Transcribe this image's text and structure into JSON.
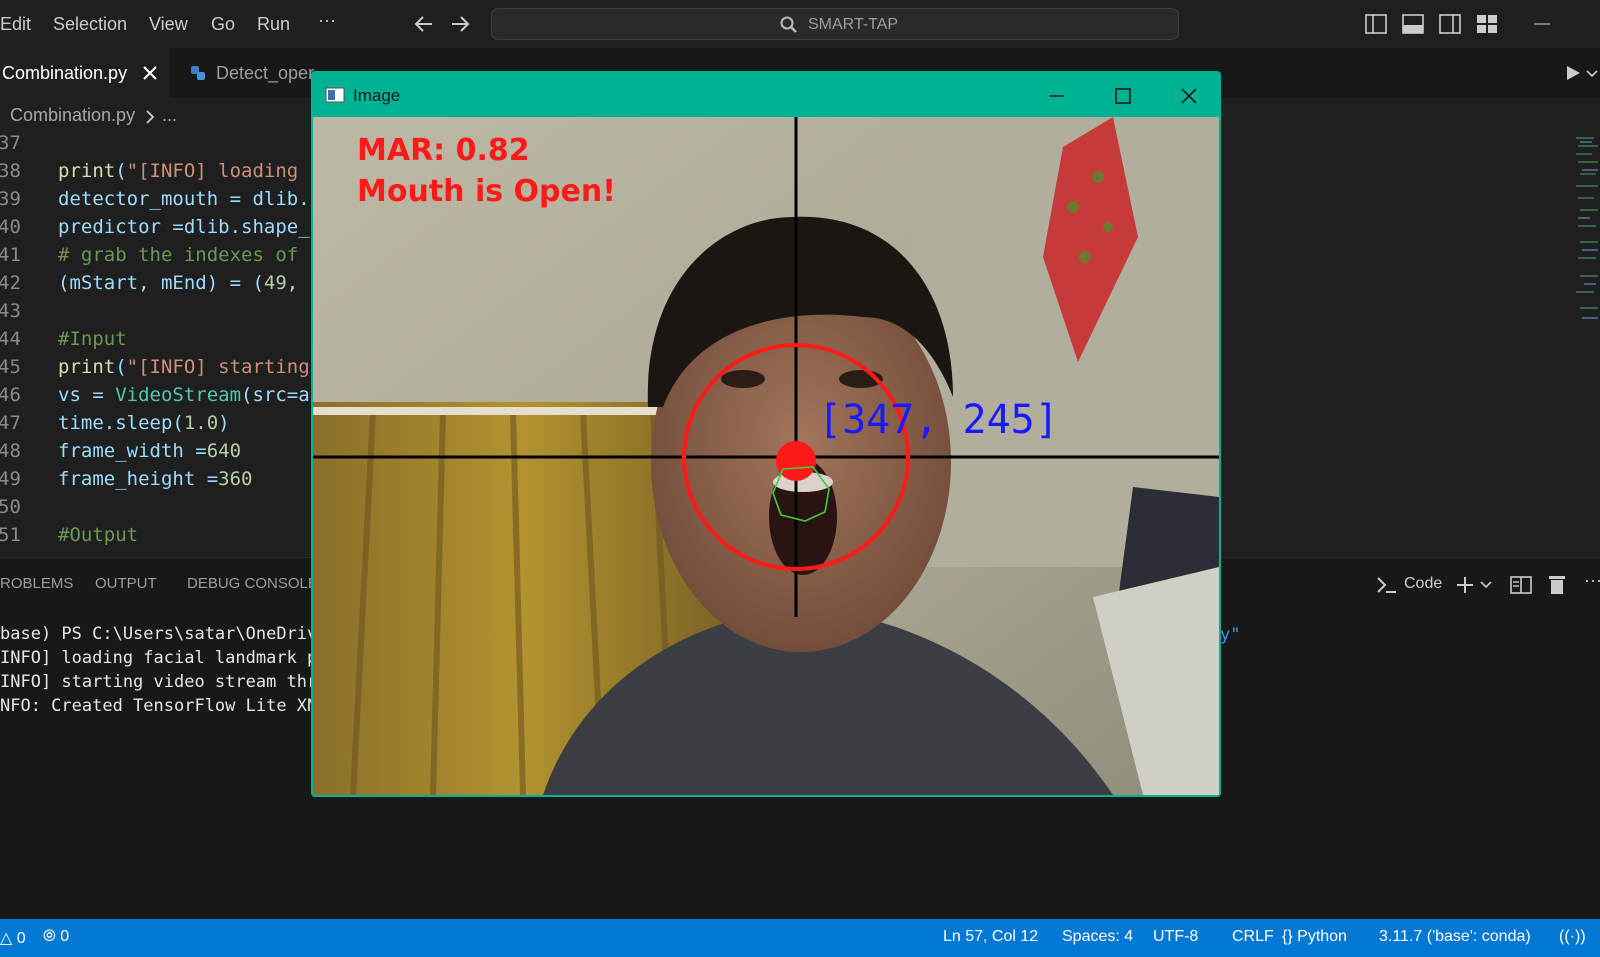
{
  "menu": [
    "Edit",
    "Selection",
    "View",
    "Go",
    "Run",
    "···"
  ],
  "search": {
    "text": "SMART-TAP",
    "icon": "search-icon"
  },
  "tabs": [
    {
      "label": "Combination.py",
      "active": true
    },
    {
      "label": "Detect_oper",
      "active": false
    }
  ],
  "breadcrumb": {
    "file": "Combination.py",
    "rest": "..."
  },
  "editor": {
    "lines": [
      {
        "num": "37",
        "code": ""
      },
      {
        "num": "38",
        "code": "print(\"[INFO] loading"
      },
      {
        "num": "39",
        "code": "detector_mouth = dlib."
      },
      {
        "num": "40",
        "code": "predictor =dlib.shape_"
      },
      {
        "num": "41",
        "code": "# grab the indexes of"
      },
      {
        "num": "42",
        "code": "(mStart, mEnd) = (49,"
      },
      {
        "num": "43",
        "code": ""
      },
      {
        "num": "44",
        "code": "#Input"
      },
      {
        "num": "45",
        "code": "print(\"[INFO] starting"
      },
      {
        "num": "46",
        "code": "vs = VideoStream(src=a"
      },
      {
        "num": "47",
        "code": "time.sleep(1.0)"
      },
      {
        "num": "48",
        "code": "frame_width =640"
      },
      {
        "num": "49",
        "code": "frame_height =360"
      },
      {
        "num": "50",
        "code": ""
      },
      {
        "num": "51",
        "code": "#Output"
      }
    ]
  },
  "panel": {
    "tabs": [
      "ROBLEMS",
      "OUTPUT",
      "DEBUG CONSOLE"
    ],
    "terminal_name": "Code",
    "terminal_lines": [
      "base) PS C:\\Users\\satar\\OneDriv",
      "INFO] loading facial landmark p",
      "INFO] starting video stream thr",
      "NFO: Created TensorFlow Lite XN"
    ],
    "trailing": "y\""
  },
  "image_window": {
    "title": "Image",
    "mar_text": "MAR: 0.82",
    "status_text": "Mouth is Open!",
    "coords_text": "[347, 245]"
  },
  "statusbar": {
    "errors": "0",
    "remote": "0",
    "position": "Ln 57, Col 12",
    "spaces": "Spaces: 4",
    "encoding": "UTF-8",
    "eol": "CRLF",
    "language": "Python",
    "interpreter": "3.11.7 ('base': conda)",
    "go_live": "Gc"
  },
  "colors": {
    "accent": "#0078d4",
    "window_border": "#00b294",
    "overlay_red": "#ff1a1a",
    "overlay_blue": "#1a1aff"
  }
}
